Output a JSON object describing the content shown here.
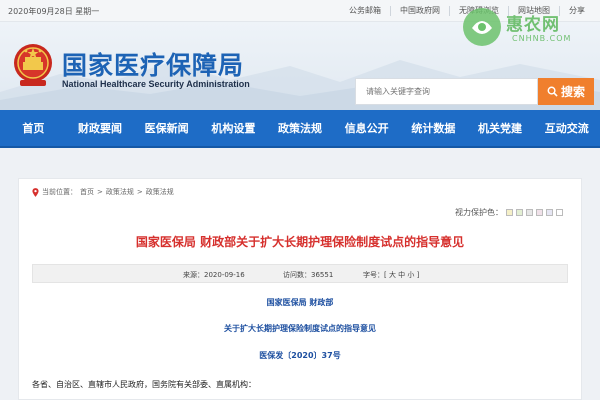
{
  "topbar": {
    "date": "2020年09月28日 星期一",
    "links": [
      "公务邮箱",
      "中国政府网",
      "无障碍浏览",
      "网站地图",
      "分享"
    ]
  },
  "header": {
    "title_cn": "国家医疗保障局",
    "title_en": "National Healthcare Security Administration",
    "search_placeholder": "请输入关键字查询",
    "search_button": "搜索"
  },
  "watermark": {
    "text": "惠农网",
    "sub": "CNHNB.COM"
  },
  "nav": [
    "首页",
    "财政要闻",
    "医保新闻",
    "机构设置",
    "政策法规",
    "信息公开",
    "统计数据",
    "机关党建",
    "互动交流"
  ],
  "breadcrumb": {
    "label": "当前位置：",
    "items": [
      "首页",
      "政策法规",
      "政策法规"
    ],
    "separator": ">"
  },
  "eye_protect": {
    "label": "视力保护色：",
    "swatches": [
      "#f5f0c8",
      "#e3efd3",
      "#e6e6e6",
      "#f0e1e9",
      "#e6e6f3",
      "#ffffff"
    ]
  },
  "article": {
    "title": "国家医保局 财政部关于扩大长期护理保险制度试点的指导意见",
    "meta": {
      "date": "来源：2020-09-16",
      "views": "访问数：36551",
      "fontsize": "字号：[ 大 中 小 ]"
    },
    "issuer": "国家医保局  财政部",
    "doc_title": "关于扩大长期护理保险制度试点的指导意见",
    "doc_number": "医保发〔2020〕37号",
    "salutation": "各省、自治区、直辖市人民政府，国务院有关部委、直属机构："
  },
  "colors": {
    "brand_blue": "#1e6cc6",
    "title_red": "#d6302d",
    "search_orange": "#f07f2d"
  }
}
